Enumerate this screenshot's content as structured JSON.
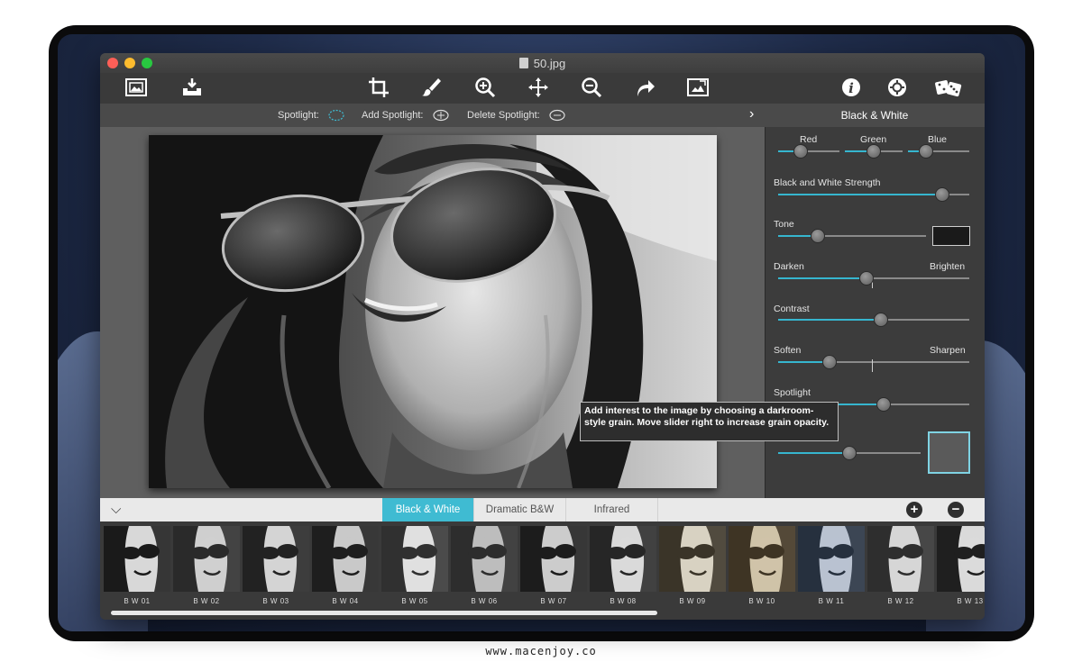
{
  "window": {
    "title": "50.jpg"
  },
  "toolbar": {
    "left": [
      "image-icon",
      "download-icon"
    ],
    "center": [
      "crop-icon",
      "brush-icon",
      "zoom-in-icon",
      "move-icon",
      "zoom-out-icon",
      "redo-icon",
      "fit-icon"
    ],
    "right": [
      "info-icon",
      "settings-icon",
      "dice-icon"
    ]
  },
  "spotlight_bar": {
    "spotlight": "Spotlight:",
    "add_spotlight": "Add Spotlight:",
    "delete_spotlight": "Delete Spotlight:"
  },
  "panel": {
    "title": "Black & White",
    "red_label": "Red",
    "green_label": "Green",
    "blue_label": "Blue",
    "red_value": 0.37,
    "green_value": 0.5,
    "blue_value": 0.3,
    "strength_label": "Black and White Strength",
    "strength_value": 0.86,
    "tone_label": "Tone",
    "tone_value": 0.27,
    "tone_color": "#1a1a1a",
    "darken_label": "Darken",
    "brighten_label": "Brighten",
    "darken_value": 0.46,
    "contrast_label": "Contrast",
    "contrast_value": 0.54,
    "soften_label": "Soften",
    "sharpen_label": "Sharpen",
    "soften_value": 0.27,
    "spotlight_label": "Spotlight",
    "spotlight_value": 0.55,
    "grain_value": 0.5,
    "grain_color": "#5a5a5a",
    "accent_color": "#36b6cf"
  },
  "tooltip": "Add interest to the image by choosing a darkroom-style grain. Move slider right to increase  grain opacity.",
  "filter_tabs": [
    "Black & White",
    "Dramatic B&W",
    "Infrared"
  ],
  "add_icon": "plus-icon",
  "remove_icon": "minus-icon",
  "thumbnails": [
    "B W 01",
    "B W 02",
    "B W 03",
    "B W 04",
    "B W 05",
    "B W 06",
    "B W 07",
    "B W 08",
    "B W 09",
    "B W 10",
    "B W 11",
    "B W 12",
    "B W 13"
  ],
  "footer": "www.macenjoy.co"
}
